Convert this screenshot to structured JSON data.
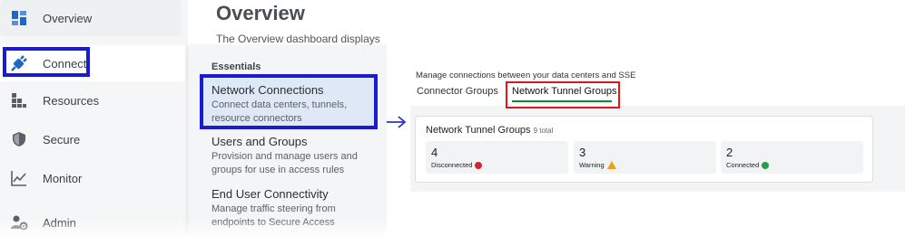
{
  "sidebar": {
    "items": [
      {
        "key": "overview",
        "label": "Overview",
        "icon": "dashboard-icon"
      },
      {
        "key": "connect",
        "label": "Connect",
        "icon": "plug-icon"
      },
      {
        "key": "resources",
        "label": "Resources",
        "icon": "resources-icon"
      },
      {
        "key": "secure",
        "label": "Secure",
        "icon": "shield-icon"
      },
      {
        "key": "monitor",
        "label": "Monitor",
        "icon": "chart-line-icon"
      },
      {
        "key": "admin",
        "label": "Admin",
        "icon": "user-gear-icon"
      }
    ]
  },
  "main": {
    "title": "Overview",
    "description": "The Overview dashboard displays"
  },
  "flyout": {
    "heading": "Essentials",
    "items": [
      {
        "title": "Network Connections",
        "description": "Connect data centers, tunnels, resource connectors"
      },
      {
        "title": "Users and Groups",
        "description": "Provision and manage users and groups for use in access rules"
      },
      {
        "title": "End User Connectivity",
        "description": "Manage traffic steering from endpoints to Secure Access"
      }
    ]
  },
  "tunnels": {
    "description": "Manage connections between your data centers and SSE",
    "tabs": [
      {
        "label": "Connector Groups"
      },
      {
        "label": "Network Tunnel Groups"
      }
    ],
    "card": {
      "title": "Network Tunnel Groups",
      "subtitle": "9 total",
      "stats": [
        {
          "value": "4",
          "label": "Disconnected",
          "status": "error"
        },
        {
          "value": "3",
          "label": "Warning",
          "status": "warning"
        },
        {
          "value": "2",
          "label": "Connected",
          "status": "success"
        }
      ]
    }
  },
  "colors": {
    "highlight_blue": "#1a1ad1",
    "highlight_red": "#e0141b",
    "tab_underline": "#0d8a2f",
    "accent_icon": "#1f66c7"
  }
}
